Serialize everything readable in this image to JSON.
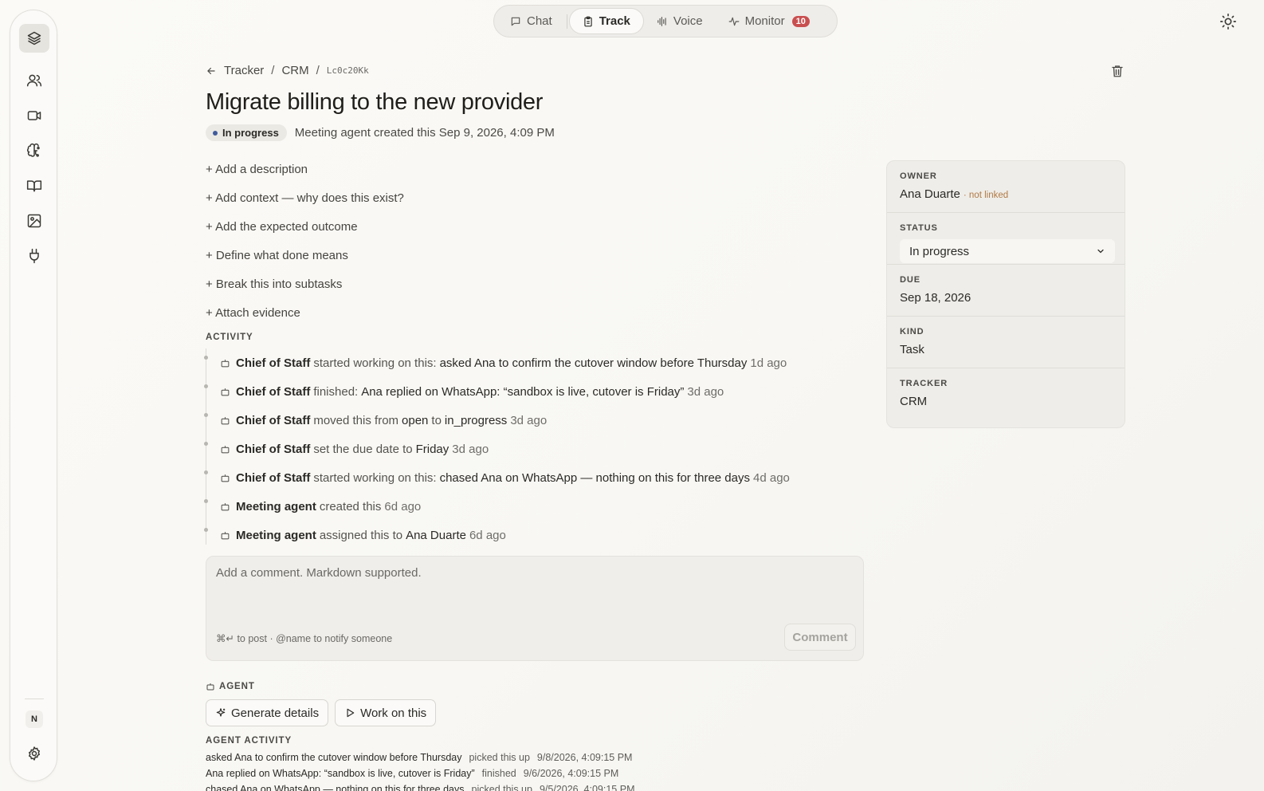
{
  "topbar": {
    "modes": [
      {
        "label": "Chat",
        "icon": "chat-bubble-icon"
      },
      {
        "label": "Track",
        "icon": "clipboard-icon",
        "active": true
      },
      {
        "label": "Voice",
        "icon": "waveform-icon"
      },
      {
        "label": "Monitor",
        "icon": "pulse-icon",
        "badge": "10"
      }
    ]
  },
  "breadcrumb": {
    "parent": "Tracker",
    "section": "CRM",
    "id": "Lc0c20Kk"
  },
  "task": {
    "title": "Migrate billing to the new provider",
    "status_pill": "In progress",
    "created_text": "Meeting agent created this Sep 9, 2026, 4:09 PM"
  },
  "add_links": [
    "+ Add a description",
    "+ Add context — why does this exist?",
    "+ Add the expected outcome",
    "+ Define what done means",
    "+ Break this into subtasks",
    "+ Attach evidence"
  ],
  "activity": {
    "label": "ACTIVITY",
    "items": [
      {
        "actor": "Chief of Staff",
        "verb": "started working on this:",
        "text": "asked Ana to confirm the cutover window before Thursday",
        "ago": "1d ago"
      },
      {
        "actor": "Chief of Staff",
        "verb": "finished:",
        "text": "Ana replied on WhatsApp: “sandbox is live, cutover is Friday”",
        "ago": "3d ago"
      },
      {
        "actor": "Chief of Staff",
        "verb": "moved this from",
        "text": "open",
        "verb2": "to",
        "text2": "in_progress",
        "ago": "3d ago"
      },
      {
        "actor": "Chief of Staff",
        "verb": "set the due date to",
        "text": "Friday",
        "ago": "3d ago"
      },
      {
        "actor": "Chief of Staff",
        "verb": "started working on this:",
        "text": "chased Ana on WhatsApp — nothing on this for three days",
        "ago": "4d ago"
      },
      {
        "actor": "Meeting agent",
        "verb": "created this",
        "text": "",
        "ago": "6d ago"
      },
      {
        "actor": "Meeting agent",
        "verb": "assigned this to",
        "text": "Ana Duarte",
        "ago": "6d ago"
      }
    ]
  },
  "comment": {
    "placeholder": "Add a comment. Markdown supported.",
    "hint": "⌘↵ to post · @name to notify someone",
    "button": "Comment"
  },
  "agent": {
    "label": "AGENT",
    "generate_label": "Generate details",
    "work_label": "Work on this",
    "activity_label": "AGENT ACTIVITY",
    "rows": [
      {
        "text": "asked Ana to confirm the cutover window before Thursday",
        "state": "picked this up",
        "time": "9/8/2026, 4:09:15 PM"
      },
      {
        "text": "Ana replied on WhatsApp: “sandbox is live, cutover is Friday”",
        "state": "finished",
        "time": "9/6/2026, 4:09:15 PM"
      },
      {
        "text": "chased Ana on WhatsApp — nothing on this for three days",
        "state": "picked this up",
        "time": "9/5/2026, 4:09:15 PM"
      }
    ]
  },
  "sidebar": {
    "owner_label": "OWNER",
    "owner": "Ana Duarte",
    "owner_note": "· not linked",
    "status_label": "STATUS",
    "status": "In progress",
    "due_label": "DUE",
    "due": "Sep 18, 2026",
    "kind_label": "KIND",
    "kind": "Task",
    "tracker_label": "TRACKER",
    "tracker": "CRM"
  },
  "rail": {
    "avatar_initial": "N"
  },
  "colors": {
    "accent_dot": "#3f5b9c",
    "badge": "#c94f4f",
    "not_linked": "#b07a45"
  }
}
